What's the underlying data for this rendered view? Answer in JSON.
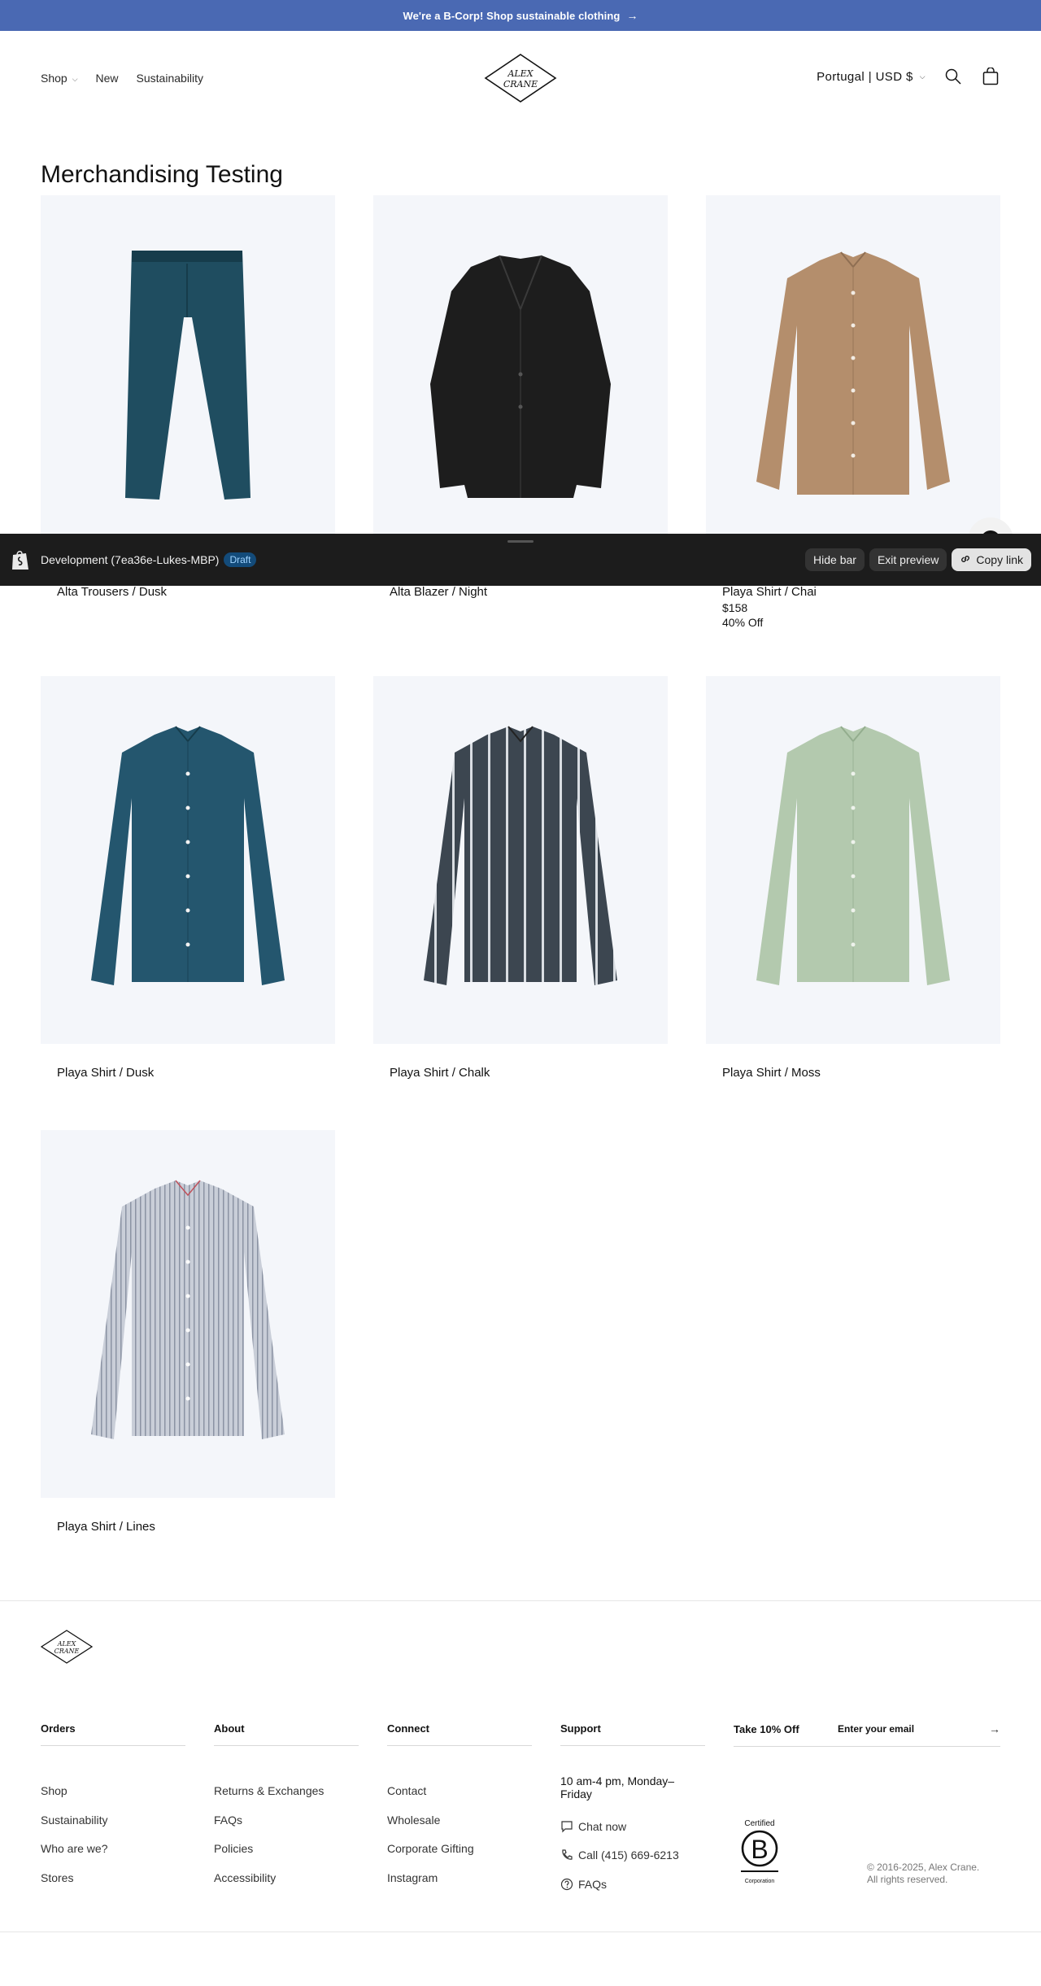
{
  "announcement": {
    "text": "We're a B-Corp! Shop sustainable clothing",
    "arrow": "→"
  },
  "header": {
    "nav": [
      {
        "label": "Shop",
        "has_dropdown": true
      },
      {
        "label": "New"
      },
      {
        "label": "Sustainability"
      }
    ],
    "logo_text": "ALEX CRANE",
    "locale": "Portugal | USD $",
    "icons": [
      "search-icon",
      "cart-icon",
      "chevron-down-icon"
    ]
  },
  "page": {
    "title": "Merchandising Testing"
  },
  "products": [
    {
      "name": "Alta Trousers / Dusk",
      "price": "",
      "discount": "",
      "image": "trousers-dusk"
    },
    {
      "name": "Alta Blazer / Night",
      "price": "",
      "discount": "",
      "image": "blazer-night"
    },
    {
      "name": "Playa Shirt / Chai",
      "price": "$158",
      "discount": "40% Off",
      "image": "shirt-chai"
    },
    {
      "name": "Playa Shirt / Dusk",
      "price": "",
      "discount": "",
      "image": "shirt-dusk"
    },
    {
      "name": "Playa Shirt / Chalk",
      "price": "",
      "discount": "",
      "image": "shirt-chalk"
    },
    {
      "name": "Playa Shirt / Moss",
      "price": "",
      "discount": "",
      "image": "shirt-moss"
    },
    {
      "name": "Playa Shirt / Lines",
      "price": "",
      "discount": "",
      "image": "shirt-lines"
    }
  ],
  "preview_bar": {
    "dev_label": "Development (7ea36e-Lukes-MBP)",
    "badge": "Draft",
    "hide": "Hide bar",
    "exit": "Exit preview",
    "copy": "Copy link"
  },
  "footer": {
    "logo_text": "ALEX CRANE",
    "columns": [
      {
        "heading": "Orders",
        "links": [
          "Shop",
          "Sustainability",
          "Who are we?",
          "Stores"
        ]
      },
      {
        "heading": "About",
        "links": [
          "Returns & Exchanges",
          "FAQs",
          "Policies",
          "Accessibility"
        ]
      },
      {
        "heading": "Connect",
        "links": [
          "Contact",
          "Wholesale",
          "Corporate Gifting",
          "Instagram"
        ]
      }
    ],
    "support": {
      "heading": "Support",
      "hours": "10 am-4 pm, Monday–Friday",
      "items": [
        {
          "icon": "chat-icon",
          "label": "Chat now"
        },
        {
          "icon": "phone-icon",
          "label": "Call (415) 669-6213"
        },
        {
          "icon": "help-icon",
          "label": "FAQs"
        }
      ]
    },
    "newsletter": {
      "heading": "Take 10% Off",
      "placeholder": "Enter your email",
      "submit": "→"
    },
    "bcorp": {
      "top": "Certified",
      "letter": "B",
      "bottom": "Corporation"
    },
    "copyright_line1": "© 2016-2025, Alex Crane.",
    "copyright_line2": "All rights reserved."
  },
  "colors": {
    "announcement_bg": "#4a69b3",
    "card_bg": "#f4f6fa",
    "preview_bar_bg": "#1c1c1c",
    "draft_badge_bg": "#134b7a"
  }
}
